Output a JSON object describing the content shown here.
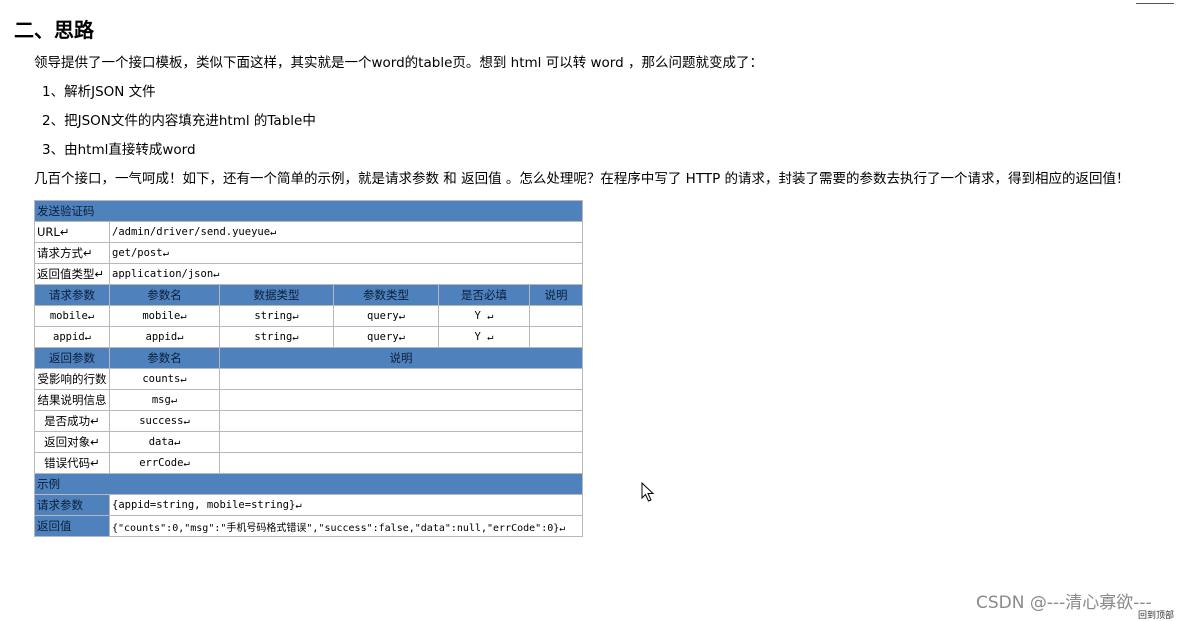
{
  "heading": "二、思路",
  "intro": "领导提供了一个接口模板，类似下面这样，其实就是一个word的table页。想到 html 可以转 word ，那么问题就变成了：",
  "steps": [
    "1、解析JSON 文件",
    "2、把JSON文件的内容填充进html 的Table中",
    "3、由html直接转成word"
  ],
  "summary": "几百个接口，一气呵成！如下，还有一个简单的示例，就是请求参数 和 返回值 。怎么处理呢？在程序中写了 HTTP 的请求，封装了需要的参数去执行了一个请求，得到相应的返回值！",
  "table": {
    "title": "发送验证码",
    "meta": [
      {
        "label": "URL↵",
        "value": "/admin/driver/send.yueyue↵"
      },
      {
        "label": "请求方式↵",
        "value": "get/post↵"
      },
      {
        "label": "返回值类型↵",
        "value": "application/json↵"
      }
    ],
    "req_headers": [
      "请求参数",
      "参数名",
      "数据类型",
      "参数类型",
      "是否必填",
      "说明"
    ],
    "req_rows": [
      [
        "mobile↵",
        "mobile↵",
        "string↵",
        "query↵",
        "Y ↵",
        ""
      ],
      [
        "appid↵",
        "appid↵",
        "string↵",
        "query↵",
        "Y ↵",
        ""
      ]
    ],
    "ret_headers": [
      "返回参数",
      "参数名",
      "说明"
    ],
    "ret_rows": [
      [
        "受影响的行数",
        "counts↵",
        ""
      ],
      [
        "结果说明信息",
        "msg↵",
        ""
      ],
      [
        "是否成功↵",
        "success↵",
        ""
      ],
      [
        "返回对象↵",
        "data↵",
        ""
      ],
      [
        "错误代码↵",
        "errCode↵",
        ""
      ]
    ],
    "example_title": "示例",
    "example_req_label": "请求参数",
    "example_req_value": "{appid=string, mobile=string}↵",
    "example_ret_label": "返回值",
    "example_ret_value": "{\"counts\":0,\"msg\":\"手机号码格式错误\",\"success\":false,\"data\":null,\"errCode\":0}↵"
  },
  "watermark": "CSDN @---清心寡欲---",
  "bottom_link": "回到顶部",
  "colors": {
    "header_bg": "#4f81bd"
  }
}
